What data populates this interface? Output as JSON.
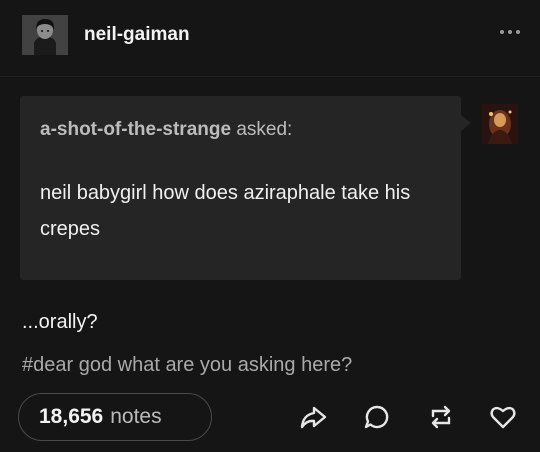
{
  "post": {
    "author": "neil-gaiman",
    "ask": {
      "asker": "a-shot-of-the-strange",
      "asked_label": "asked:",
      "question": "neil babygirl how does aziraphale take his crepes"
    },
    "answer": "...orally?",
    "tags": "#dear god what are you asking here?",
    "notes_count": "18,656",
    "notes_label": "notes"
  },
  "icons": {
    "more": "more-options-icon",
    "share": "share-icon",
    "reply": "reply-icon",
    "reblog": "reblog-icon",
    "like": "like-icon"
  },
  "colors": {
    "background": "#151515",
    "ask_background": "#252525",
    "text_primary": "#f2f2f2",
    "text_secondary": "#a9a9a9"
  }
}
